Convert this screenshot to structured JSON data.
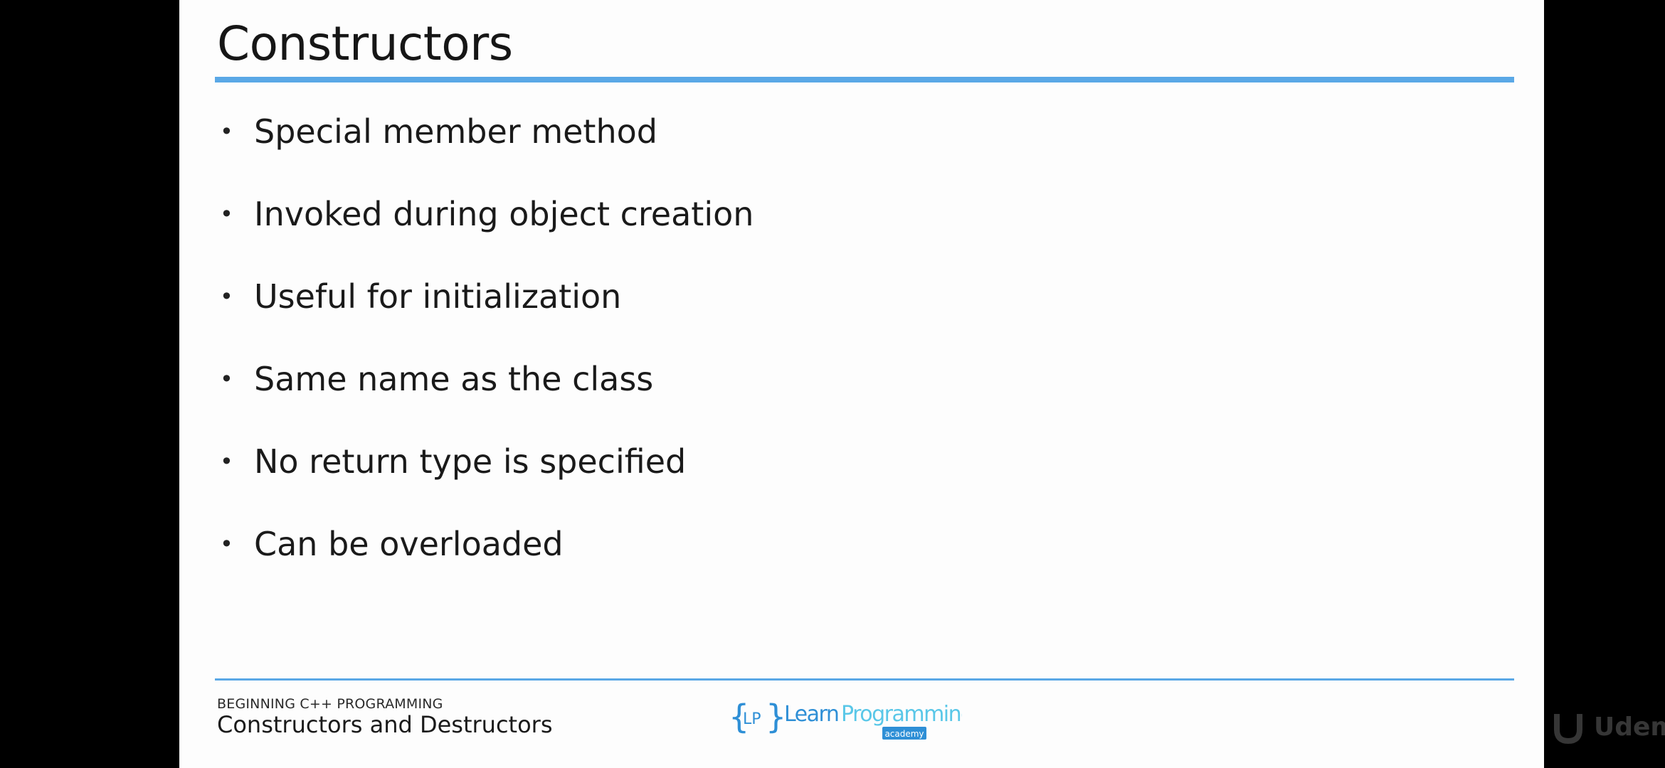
{
  "slide": {
    "title": "Constructors",
    "bullets": [
      "Special member method",
      "Invoked during object creation",
      "Useful for initialization",
      "Same name as the class",
      "No return type is specified",
      "Can be overloaded"
    ],
    "bullet_glyph": "•"
  },
  "footer": {
    "course": "BEGINNING C++ PROGRAMMING",
    "lecture": "Constructors and Destructors",
    "logo": {
      "brace_left": "{",
      "brace_right": "}",
      "initials": "LP",
      "word1": "Learn",
      "word2": "Programming",
      "sub": "academy"
    },
    "watermark": "Udemy"
  },
  "colors": {
    "accent": "#5aa8e6",
    "logo_blue": "#2e8fd6",
    "logo_teal": "#59c7e8",
    "slide_bg": "#fdfdfd",
    "frame_bg": "#000000"
  }
}
